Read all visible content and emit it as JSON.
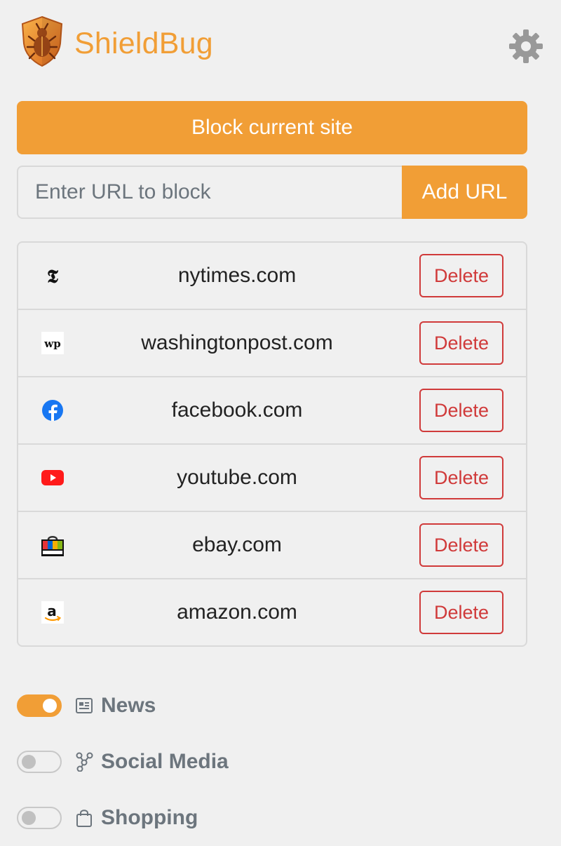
{
  "header": {
    "brand": "ShieldBug",
    "logo_icon": "shield-bug-logo-icon",
    "settings_icon": "gear-icon"
  },
  "block_button_label": "Block current site",
  "add_url": {
    "placeholder": "Enter URL to block",
    "value": "",
    "button_label": "Add URL"
  },
  "blocked_sites": [
    {
      "domain": "nytimes.com",
      "icon": "nytimes-favicon",
      "delete_label": "Delete"
    },
    {
      "domain": "washingtonpost.com",
      "icon": "washingtonpost-favicon",
      "delete_label": "Delete"
    },
    {
      "domain": "facebook.com",
      "icon": "facebook-favicon",
      "delete_label": "Delete"
    },
    {
      "domain": "youtube.com",
      "icon": "youtube-favicon",
      "delete_label": "Delete"
    },
    {
      "domain": "ebay.com",
      "icon": "ebay-favicon",
      "delete_label": "Delete"
    },
    {
      "domain": "amazon.com",
      "icon": "amazon-favicon",
      "delete_label": "Delete"
    }
  ],
  "categories": [
    {
      "label": "News",
      "enabled": true,
      "icon": "newspaper-icon"
    },
    {
      "label": "Social Media",
      "enabled": false,
      "icon": "share-nodes-icon"
    },
    {
      "label": "Shopping",
      "enabled": false,
      "icon": "shopping-bag-icon"
    }
  ],
  "colors": {
    "accent": "#f19e36",
    "danger": "#d03a3a",
    "muted_text": "#6c757d",
    "background": "#f0f0f0",
    "border": "#d9d9d9"
  }
}
